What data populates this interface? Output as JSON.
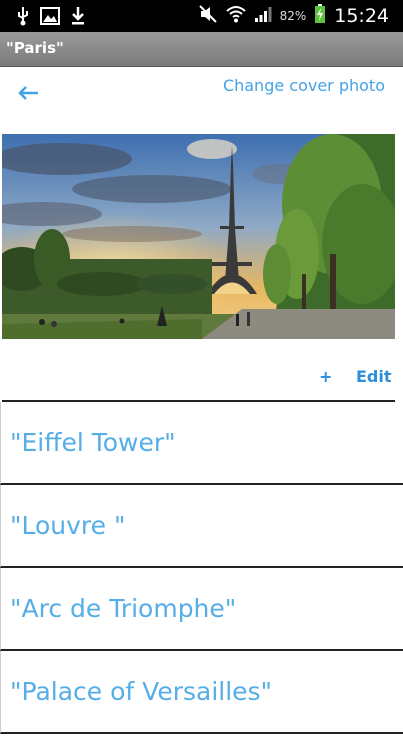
{
  "status_bar": {
    "left_icons": [
      "usb-icon",
      "image-icon",
      "download-icon"
    ],
    "right_icons": [
      "mute-icon",
      "wifi-icon",
      "signal-icon",
      "battery-charging-icon"
    ],
    "battery_percent": "82%",
    "time": "15:24"
  },
  "title_bar": {
    "title": "\"Paris\""
  },
  "header": {
    "back_icon": "arrow-left-icon",
    "change_cover_label": "Change cover photo"
  },
  "cover_photo": {
    "subject": "eiffel-tower-photo"
  },
  "actions": {
    "add_label": "+",
    "edit_label": "Edit"
  },
  "places": [
    {
      "label": "\"Eiffel Tower\""
    },
    {
      "label": "\"Louvre \""
    },
    {
      "label": "\"Arc de Triomphe\""
    },
    {
      "label": "\"Palace of Versailles\""
    }
  ],
  "colors": {
    "accent": "#44a3e8",
    "status_bar": "#000000",
    "title_bar": "#8a8a8a"
  }
}
